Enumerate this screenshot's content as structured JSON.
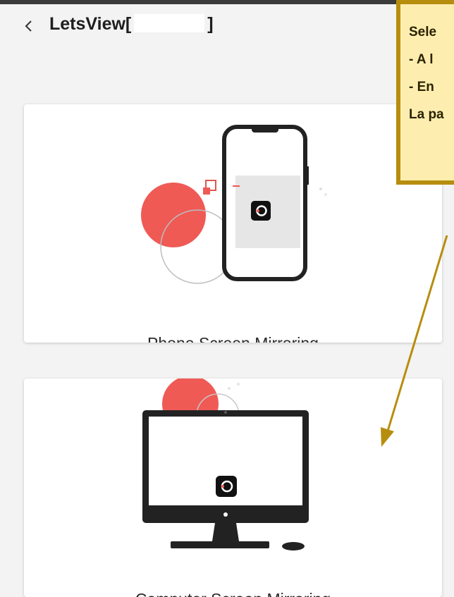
{
  "header": {
    "title_prefix": "LetsView[",
    "title_suffix": "]",
    "back_icon": "chevron-left-icon"
  },
  "cards": [
    {
      "label": "Phone Screen Mirroring",
      "illustration": "phone-mirroring-illustration"
    },
    {
      "label": "Computer Screen Mirroring",
      "illustration": "computer-mirroring-illustration"
    }
  ],
  "tooltip": {
    "lines": [
      "Sele",
      " - A l",
      " - En",
      "La pa"
    ],
    "colors": {
      "background": "#fdeeb0",
      "border": "#b78d0e"
    }
  },
  "colors": {
    "accent_red": "#ef5a55",
    "background": "#f3f3f3"
  }
}
